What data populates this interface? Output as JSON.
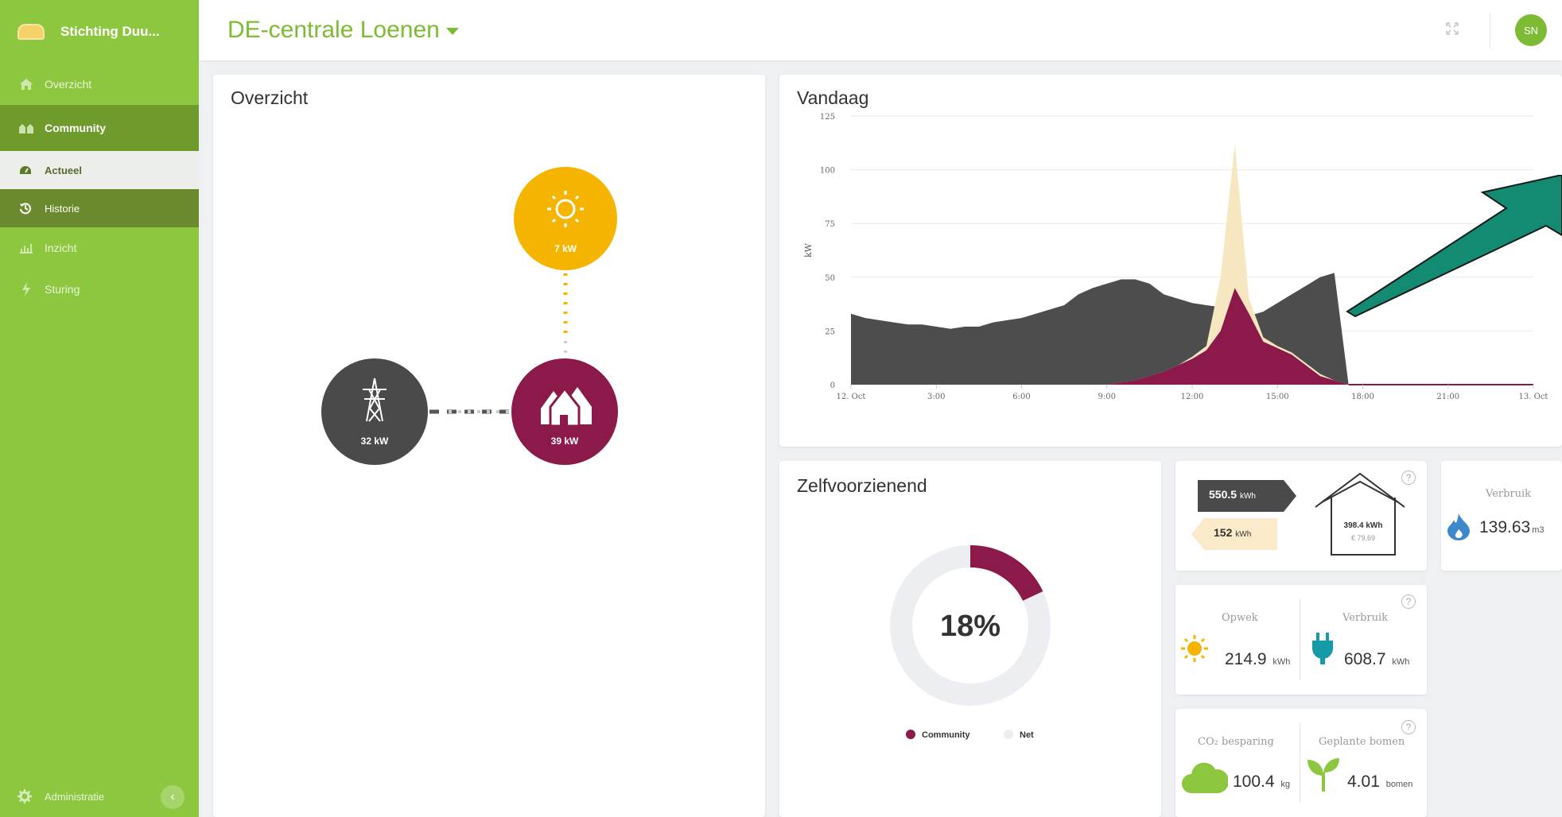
{
  "sidebar": {
    "brand": "Stichting Duu...",
    "items": [
      {
        "label": "Overzicht"
      },
      {
        "label": "Community"
      },
      {
        "label": "Actueel"
      },
      {
        "label": "Historie"
      },
      {
        "label": "Inzicht"
      },
      {
        "label": "Sturing"
      }
    ],
    "bottom": "Administratie",
    "collapse": "‹"
  },
  "header": {
    "title": "DE-centrale Loenen",
    "avatar": "SN",
    "expand_icon": "expand-icon"
  },
  "overzicht": {
    "title": "Overzicht",
    "solar": "7 kW",
    "grid": "32 kW",
    "community": "39 kW"
  },
  "vandaag": {
    "title": "Vandaag"
  },
  "chart_data": {
    "type": "area",
    "title": "",
    "ylabel": "kW",
    "xlabel": "",
    "ylim": [
      0,
      125
    ],
    "yticks": [
      0,
      25,
      50,
      75,
      100,
      125
    ],
    "xticks": [
      "12. Oct",
      "3:00",
      "6:00",
      "9:00",
      "12:00",
      "15:00",
      "18:00",
      "21:00",
      "13. Oct"
    ],
    "x_hours": [
      0,
      0.5,
      1,
      1.5,
      2,
      2.5,
      3,
      3.5,
      4,
      4.5,
      5,
      5.5,
      6,
      6.5,
      7,
      7.5,
      8,
      8.5,
      9,
      9.5,
      10,
      10.5,
      11,
      11.5,
      12,
      12.5,
      13,
      13.5,
      14,
      14.5,
      15,
      15.5,
      16,
      16.5,
      17,
      17.5
    ],
    "colors": {
      "verbruik": "#4d4d4d",
      "opwek": "#f7e7c0",
      "community": "#8b1a4a"
    },
    "series": [
      {
        "key": "verbruik",
        "values": [
          33,
          31,
          30,
          29,
          28,
          28,
          27,
          26,
          27,
          27,
          29,
          30,
          31,
          33,
          35,
          37,
          42,
          45,
          47,
          49,
          49,
          47,
          42,
          40,
          38,
          37,
          36,
          34,
          32,
          34,
          38,
          42,
          46,
          50,
          52,
          0
        ]
      },
      {
        "key": "opwek",
        "values": [
          0,
          0,
          0,
          0,
          0,
          0,
          0,
          0,
          0,
          0,
          0,
          0,
          0,
          0,
          0,
          0,
          0,
          0,
          0,
          1,
          2,
          4,
          6,
          9,
          13,
          18,
          50,
          112,
          40,
          22,
          18,
          15,
          10,
          5,
          2,
          0
        ]
      },
      {
        "key": "community",
        "values": [
          0,
          0,
          0,
          0,
          0,
          0,
          0,
          0,
          0,
          0,
          0,
          0,
          0,
          0,
          0,
          0,
          0,
          0,
          0,
          1,
          2,
          4,
          6,
          9,
          12,
          16,
          25,
          45,
          33,
          20,
          17,
          14,
          9,
          4,
          2,
          0
        ]
      }
    ]
  },
  "zelfvoorzienend": {
    "title": "Zelfvoorzienend",
    "percent_label": "18%",
    "percent": 0.18,
    "legend_community": "Community",
    "legend_net": "Net"
  },
  "energy_flow": {
    "import": "550.5",
    "import_unit": "kWh",
    "export": "152",
    "export_unit": "kWh",
    "house_kwh": "398.4 kWh",
    "house_cost": "€ 79,69"
  },
  "gas": {
    "label": "Verbruik",
    "value": "139.63",
    "unit": "m3"
  },
  "production": {
    "opwek_label": "Opwek",
    "opwek_value": "214.9",
    "opwek_unit": "kWh",
    "verbruik_label": "Verbruik",
    "verbruik_value": "608.7",
    "verbruik_unit": "kWh"
  },
  "co2": {
    "co2_label": "CO₂ besparing",
    "co2_value": "100.4",
    "co2_unit": "kg",
    "trees_label": "Geplante bomen",
    "trees_value": "4.01",
    "trees_unit": "bomen"
  }
}
